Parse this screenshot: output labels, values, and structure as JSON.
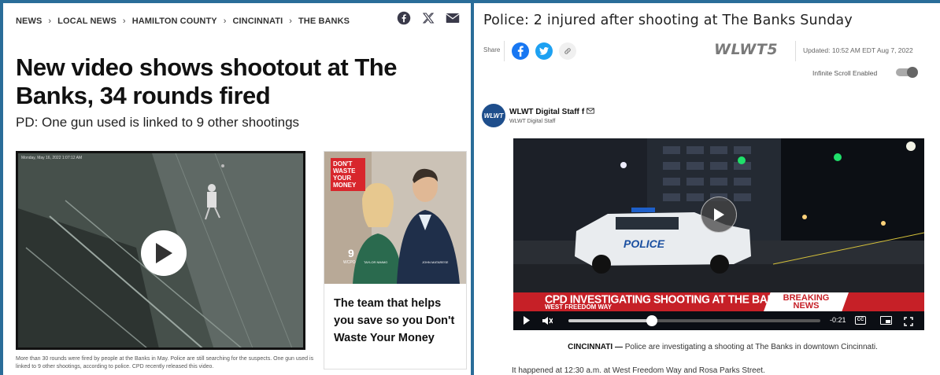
{
  "left": {
    "breadcrumbs": [
      "NEWS",
      "LOCAL NEWS",
      "HAMILTON COUNTY",
      "CINCINNATI",
      "THE BANKS"
    ],
    "headline": "New video shows shootout at The Banks, 34 rounds fired",
    "subhead": "PD: One gun used is linked to 9 other shootings",
    "video_timestamp": "Monday, May 16, 2022 1:07:12 AM",
    "caption": "More than 30 rounds were fired by people at the Banks in May. Police are still searching for the suspects. One gun used is linked to 9 other shootings, according to police. CPD recently released this video.",
    "ad": {
      "badge": [
        "DON'T",
        "WASTE",
        "YOUR",
        "MONEY"
      ],
      "text": "The team that helps you save so you Don't Waste Your Money",
      "logo": "9 WCPO"
    },
    "icons": [
      "facebook-icon",
      "x-icon",
      "mail-icon"
    ]
  },
  "right": {
    "title": "Police: 2 injured after shooting at The Banks Sunday",
    "share_label": "Share",
    "brand": "WLWT5",
    "updated": "Updated: 10:52 AM EDT Aug 7, 2022",
    "infinite_scroll": "Infinite Scroll Enabled",
    "author": "WLWT Digital Staff",
    "author_sub": "WLWT Digital Staff",
    "author_logo": "WLWT",
    "video": {
      "lower_third_main": "CPD INVESTIGATING SHOOTING AT THE BANKS",
      "lower_third_sub": "WEST FREEDOM WAY",
      "breaking_1": "BREAKING",
      "breaking_2": "NEWS",
      "time_remaining": "-0:21",
      "cc_label": "CC",
      "progress": 0.33,
      "car_label": "POLICE"
    },
    "para1_lead": "CINCINNATI —",
    "para1_rest": " Police are investigating a shooting at The Banks in downtown Cincinnati.",
    "para2": "It happened at 12:30 a.m. at West Freedom Way and Rosa Parks Street."
  },
  "colors": {
    "frame": "#2a6d99",
    "facebook": "#1877f2",
    "twitter": "#1da1f2",
    "breaking_red": "#c62027"
  }
}
